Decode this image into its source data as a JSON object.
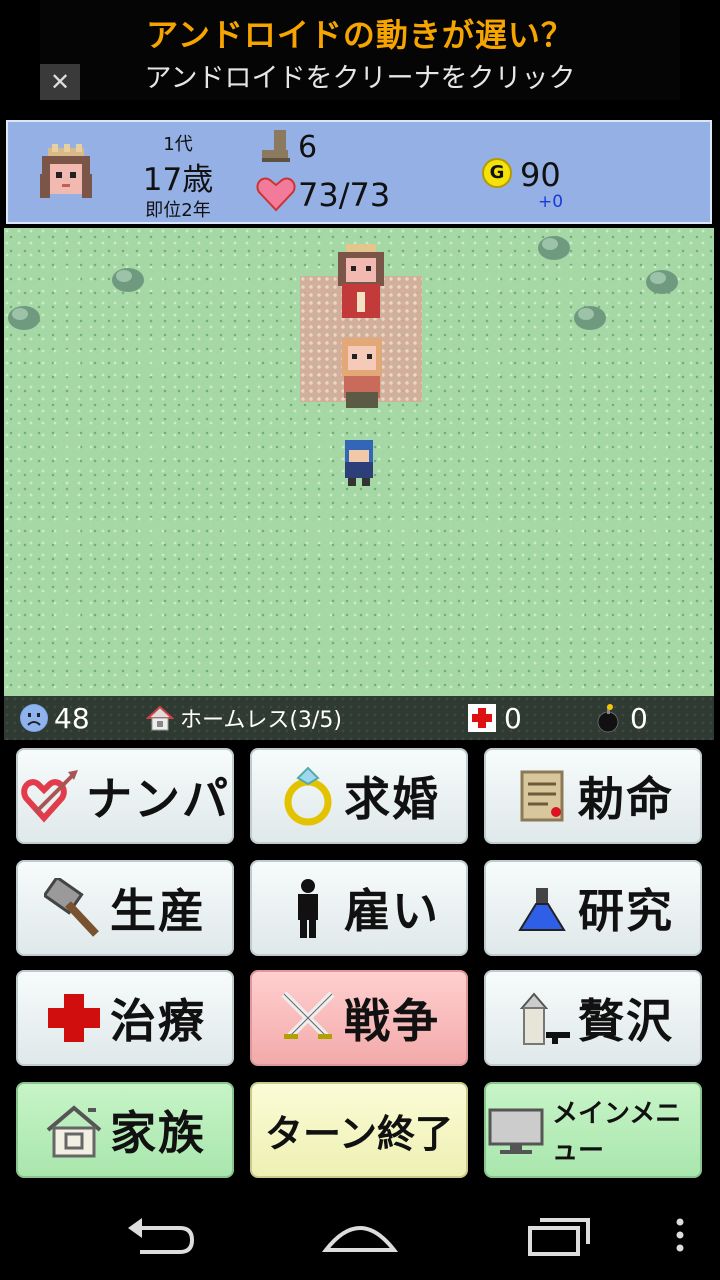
{
  "ad": {
    "headline": "アンドロイドの動きが遅い？",
    "subline": "アンドロイドをクリーナをクリック",
    "close": "✕"
  },
  "hud": {
    "generation": "1代",
    "age": "17歳",
    "reign": "即位2年",
    "steps": "6",
    "hp": "73/73",
    "gold": "90",
    "gold_delta": "+0",
    "coin_letter": "G"
  },
  "status": {
    "mood": "48",
    "home": "ホームレス(3/5)",
    "medicine": "0",
    "bombs": "0"
  },
  "buttons": {
    "nanpa": "ナンパ",
    "propose": "求婚",
    "edict": "勅命",
    "produce": "生産",
    "hire": "雇い",
    "research": "研究",
    "heal": "治療",
    "war": "戦争",
    "luxury": "贅沢",
    "family": "家族",
    "end_turn": "ターン終了",
    "main_menu": "メインメニュー"
  },
  "colors": {
    "hud_bg": "#94b0e4",
    "field_grass": "#a6d8a6",
    "war_button": "#f3aaaa",
    "family_button": "#a9e6ad",
    "end_turn_button": "#eef0b4",
    "ad_accent": "#f6a400"
  }
}
